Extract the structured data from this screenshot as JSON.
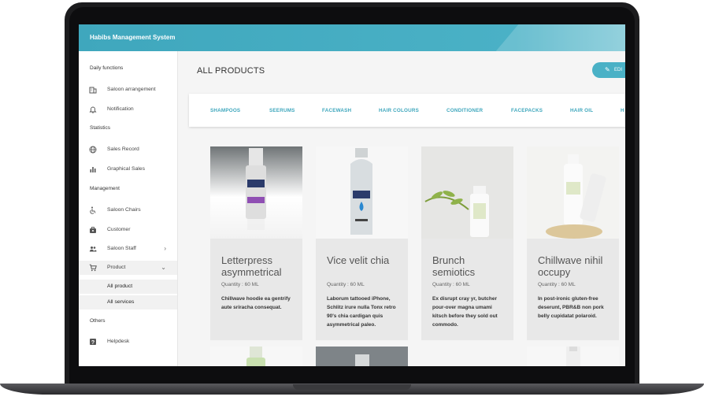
{
  "app": {
    "title": "Habibs Management System"
  },
  "sidebar": {
    "sections": [
      {
        "label": "Daily functions"
      },
      {
        "label": "Statistics"
      },
      {
        "label": "Management"
      },
      {
        "label": "Others"
      }
    ],
    "items": [
      {
        "label": "Saloon arrangement",
        "icon": "building-icon"
      },
      {
        "label": "Notification",
        "icon": "bell-icon"
      },
      {
        "label": "Sales Record",
        "icon": "globe-icon"
      },
      {
        "label": "Graphical Sales",
        "icon": "bar-chart-icon"
      },
      {
        "label": "Saloon Chairs",
        "icon": "wheelchair-icon"
      },
      {
        "label": "Customer",
        "icon": "briefcase-icon"
      },
      {
        "label": "Saloon Staff",
        "icon": "people-icon"
      },
      {
        "label": "Product",
        "icon": "cart-icon"
      },
      {
        "label": "Helpdesk",
        "icon": "help-icon"
      }
    ],
    "subitems": [
      {
        "label": "All product"
      },
      {
        "label": "All services"
      }
    ]
  },
  "main": {
    "title": "ALL PRODUCTS",
    "edit_label": "EDI",
    "tabs": [
      "SHAMPOOS",
      "SEERUMS",
      "FACEWASH",
      "HAIR COLOURS",
      "CONDITIONER",
      "FACEPACKS",
      "HAIR OIL",
      "H"
    ]
  },
  "products": [
    {
      "name": "Letterpress asymmetrical",
      "quantity": "Quantity : 60 ML",
      "desc": "Chillwave hoodie ea gentrify aute sriracha consequat."
    },
    {
      "name": "Vice velit chia",
      "quantity": "Quantity : 60 ML",
      "desc": "Laborum tattooed iPhone, Schlitz irure nulla Tonx retro 90's chia cardigan quis asymmetrical paleo."
    },
    {
      "name": "Brunch semiotics",
      "quantity": "Quantity : 60 ML",
      "desc": "Ex disrupt cray yr, butcher pour-over magna umami kitsch before they sold out commodo."
    },
    {
      "name": "Chillwave nihil occupy",
      "quantity": "Quantity : 60 ML",
      "desc": "In post-ironic gluten-free deserunt, PBR&B non pork belly cupidatat polaroid."
    }
  ],
  "colors": {
    "accent": "#4ab1c6",
    "tab_text": "#3fa7bd"
  }
}
